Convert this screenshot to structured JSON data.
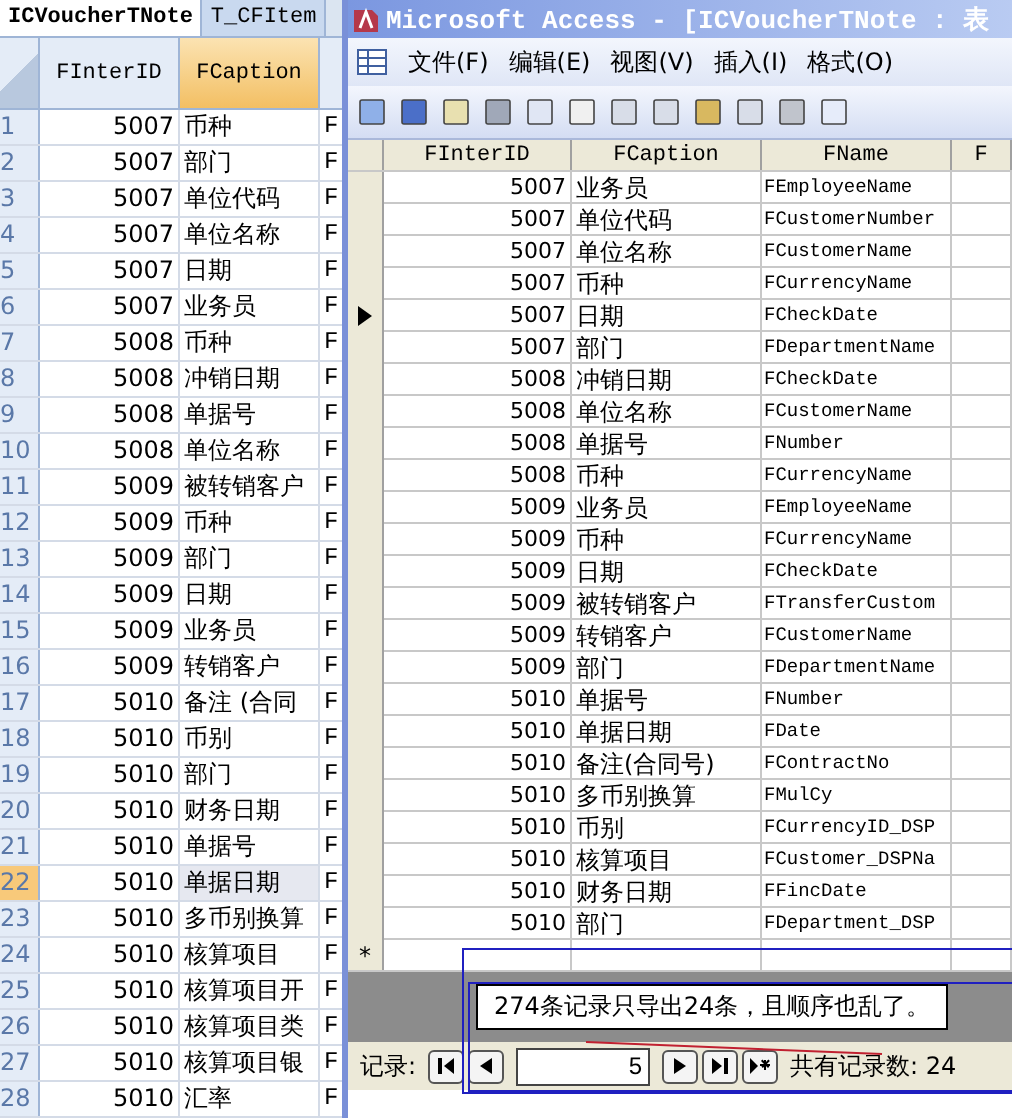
{
  "sheet": {
    "tabs": [
      {
        "label": "ICVoucherTNote",
        "selected": true
      },
      {
        "label": "T_CFItem",
        "selected": false
      }
    ],
    "columns": [
      {
        "label": "FInterID",
        "selected": false
      },
      {
        "label": "FCaption",
        "selected": true
      }
    ],
    "rows": [
      {
        "number": "1",
        "finterid": "5007",
        "fcaption": "币种",
        "column_3": "F",
        "selected": false
      },
      {
        "number": "2",
        "finterid": "5007",
        "fcaption": "部门",
        "column_3": "F",
        "selected": false
      },
      {
        "number": "3",
        "finterid": "5007",
        "fcaption": "单位代码",
        "column_3": "F",
        "selected": false
      },
      {
        "number": "4",
        "finterid": "5007",
        "fcaption": "单位名称",
        "column_3": "F",
        "selected": false
      },
      {
        "number": "5",
        "finterid": "5007",
        "fcaption": "日期",
        "column_3": "F",
        "selected": false
      },
      {
        "number": "6",
        "finterid": "5007",
        "fcaption": "业务员",
        "column_3": "F",
        "selected": false
      },
      {
        "number": "7",
        "finterid": "5008",
        "fcaption": "币种",
        "column_3": "F",
        "selected": false
      },
      {
        "number": "8",
        "finterid": "5008",
        "fcaption": "冲销日期",
        "column_3": "F",
        "selected": false
      },
      {
        "number": "9",
        "finterid": "5008",
        "fcaption": "单据号",
        "column_3": "F",
        "selected": false
      },
      {
        "number": "10",
        "finterid": "5008",
        "fcaption": "单位名称",
        "column_3": "F",
        "selected": false
      },
      {
        "number": "11",
        "finterid": "5009",
        "fcaption": "被转销客户",
        "column_3": "F",
        "selected": false
      },
      {
        "number": "12",
        "finterid": "5009",
        "fcaption": "币种",
        "column_3": "F",
        "selected": false
      },
      {
        "number": "13",
        "finterid": "5009",
        "fcaption": "部门",
        "column_3": "F",
        "selected": false
      },
      {
        "number": "14",
        "finterid": "5009",
        "fcaption": "日期",
        "column_3": "F",
        "selected": false
      },
      {
        "number": "15",
        "finterid": "5009",
        "fcaption": "业务员",
        "column_3": "F",
        "selected": false
      },
      {
        "number": "16",
        "finterid": "5009",
        "fcaption": "转销客户",
        "column_3": "F",
        "selected": false
      },
      {
        "number": "17",
        "finterid": "5010",
        "fcaption": "备注 (合同",
        "column_3": "F",
        "selected": false
      },
      {
        "number": "18",
        "finterid": "5010",
        "fcaption": "币别",
        "column_3": "F",
        "selected": false
      },
      {
        "number": "19",
        "finterid": "5010",
        "fcaption": "部门",
        "column_3": "F",
        "selected": false
      },
      {
        "number": "20",
        "finterid": "5010",
        "fcaption": "财务日期",
        "column_3": "F",
        "selected": false
      },
      {
        "number": "21",
        "finterid": "5010",
        "fcaption": "单据号",
        "column_3": "F",
        "selected": false
      },
      {
        "number": "22",
        "finterid": "5010",
        "fcaption": "单据日期",
        "column_3": "F",
        "selected": true
      },
      {
        "number": "23",
        "finterid": "5010",
        "fcaption": "多币别换算",
        "column_3": "F",
        "selected": false
      },
      {
        "number": "24",
        "finterid": "5010",
        "fcaption": "核算项目",
        "column_3": "F",
        "selected": false
      },
      {
        "number": "25",
        "finterid": "5010",
        "fcaption": "核算项目开",
        "column_3": "F",
        "selected": false
      },
      {
        "number": "26",
        "finterid": "5010",
        "fcaption": "核算项目类",
        "column_3": "F",
        "selected": false
      },
      {
        "number": "27",
        "finterid": "5010",
        "fcaption": "核算项目银",
        "column_3": "F",
        "selected": false
      },
      {
        "number": "28",
        "finterid": "5010",
        "fcaption": "汇率",
        "column_3": "F",
        "selected": false
      }
    ]
  },
  "access": {
    "title": "Microsoft Access - [ICVoucherTNote : 表",
    "menu": [
      "文件(F)",
      "编辑(E)",
      "视图(V)",
      "插入(I)",
      "格式(O)"
    ],
    "columns": [
      "FInterID",
      "FCaption",
      "FName",
      "F"
    ],
    "rows": [
      {
        "finterid": "5007",
        "fcaption": "业务员",
        "fname": "FEmployeeName",
        "current": false
      },
      {
        "finterid": "5007",
        "fcaption": "单位代码",
        "fname": "FCustomerNumber",
        "current": false
      },
      {
        "finterid": "5007",
        "fcaption": "单位名称",
        "fname": "FCustomerName",
        "current": false
      },
      {
        "finterid": "5007",
        "fcaption": "币种",
        "fname": "FCurrencyName",
        "current": false
      },
      {
        "finterid": "5007",
        "fcaption": "日期",
        "fname": "FCheckDate",
        "current": true
      },
      {
        "finterid": "5007",
        "fcaption": "部门",
        "fname": "FDepartmentName",
        "current": false
      },
      {
        "finterid": "5008",
        "fcaption": "冲销日期",
        "fname": "FCheckDate",
        "current": false
      },
      {
        "finterid": "5008",
        "fcaption": "单位名称",
        "fname": "FCustomerName",
        "current": false
      },
      {
        "finterid": "5008",
        "fcaption": "单据号",
        "fname": "FNumber",
        "current": false
      },
      {
        "finterid": "5008",
        "fcaption": "币种",
        "fname": "FCurrencyName",
        "current": false
      },
      {
        "finterid": "5009",
        "fcaption": "业务员",
        "fname": "FEmployeeName",
        "current": false
      },
      {
        "finterid": "5009",
        "fcaption": "币种",
        "fname": "FCurrencyName",
        "current": false
      },
      {
        "finterid": "5009",
        "fcaption": "日期",
        "fname": "FCheckDate",
        "current": false
      },
      {
        "finterid": "5009",
        "fcaption": "被转销客户",
        "fname": "FTransferCustom",
        "current": false
      },
      {
        "finterid": "5009",
        "fcaption": "转销客户",
        "fname": "FCustomerName",
        "current": false
      },
      {
        "finterid": "5009",
        "fcaption": "部门",
        "fname": "FDepartmentName",
        "current": false
      },
      {
        "finterid": "5010",
        "fcaption": "单据号",
        "fname": "FNumber",
        "current": false
      },
      {
        "finterid": "5010",
        "fcaption": "单据日期",
        "fname": "FDate",
        "current": false
      },
      {
        "finterid": "5010",
        "fcaption": "备注(合同号)",
        "fname": "FContractNo",
        "current": false
      },
      {
        "finterid": "5010",
        "fcaption": "多币别换算",
        "fname": "FMulCy",
        "current": false
      },
      {
        "finterid": "5010",
        "fcaption": "币别",
        "fname": "FCurrencyID_DSP",
        "current": false
      },
      {
        "finterid": "5010",
        "fcaption": "核算项目",
        "fname": "FCustomer_DSPNa",
        "current": false
      },
      {
        "finterid": "5010",
        "fcaption": "财务日期",
        "fname": "FFincDate",
        "current": false
      },
      {
        "finterid": "5010",
        "fcaption": "部门",
        "fname": "FDepartment_DSP",
        "current": false
      }
    ],
    "new_row_marker": "*",
    "annotation": "274条记录只导出24条，且顺序也乱了。",
    "nav": {
      "label": "记录:",
      "record": "5",
      "total": "共有记录数: 24"
    }
  }
}
